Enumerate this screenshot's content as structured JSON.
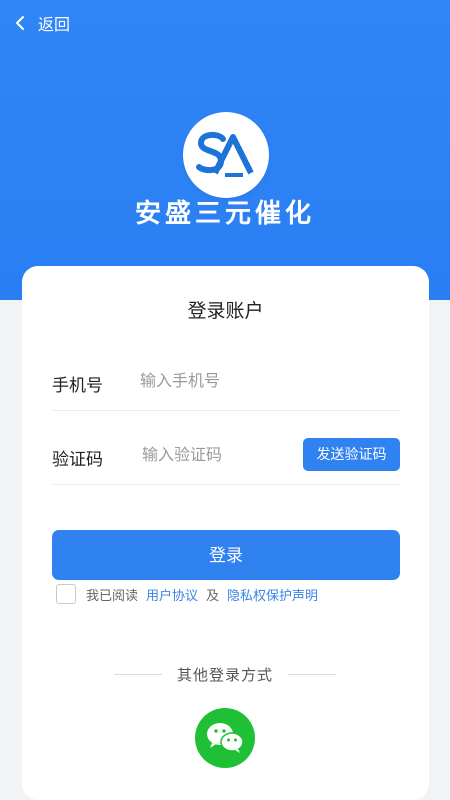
{
  "header": {
    "back_label": "返回"
  },
  "brand": {
    "name": "安盛三元催化"
  },
  "login": {
    "title": "登录账户",
    "phone": {
      "label": "手机号",
      "placeholder": "输入手机号",
      "value": ""
    },
    "code": {
      "label": "验证码",
      "placeholder": "输入验证码",
      "value": "",
      "send_label": "发送验证码"
    },
    "submit_label": "登录",
    "agreement": {
      "prefix": "我已阅读",
      "user_agreement": "用户协议",
      "and": "及",
      "privacy_policy": "隐私权保护声明",
      "checked": false
    },
    "other_methods": {
      "title": "其他登录方式",
      "wechat_icon": "wechat-icon"
    }
  },
  "colors": {
    "hero": "#2f86f6",
    "accent": "#2f82f0",
    "wechat": "#1fc035"
  }
}
